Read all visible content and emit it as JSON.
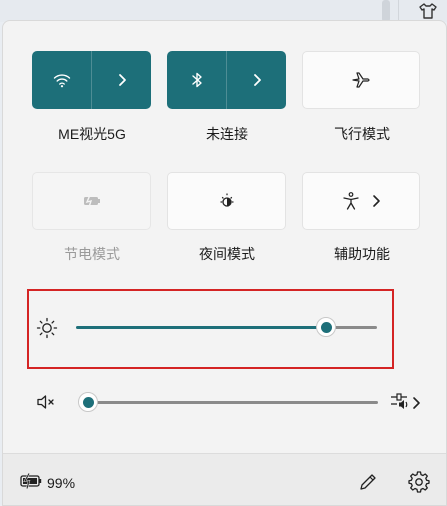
{
  "colors": {
    "accent": "#1d6f79",
    "track_inactive": "#8a8a8a",
    "highlight_border": "#d42424"
  },
  "quick_settings": {
    "tiles": [
      {
        "label": "ME视光5G",
        "state": "on",
        "icon": "wifi-icon",
        "has_chevron": true
      },
      {
        "label": "未连接",
        "state": "on",
        "icon": "bluetooth-icon",
        "has_chevron": true
      },
      {
        "label": "飞行模式",
        "state": "off",
        "icon": "airplane-icon"
      },
      {
        "label": "节电模式",
        "state": "disabled",
        "icon": "battery-saver-icon"
      },
      {
        "label": "夜间模式",
        "state": "off",
        "icon": "night-light-icon"
      },
      {
        "label": "辅助功能",
        "state": "off",
        "icon": "accessibility-icon",
        "has_chevron": true
      }
    ],
    "brightness": {
      "icon": "brightness-icon",
      "value_fraction": 0.83
    },
    "volume": {
      "icon": "speaker-muted-icon",
      "value_fraction": 0.0,
      "output_icon": "audio-output-icon"
    }
  },
  "footer": {
    "battery_percent": "99%",
    "battery_icon": "battery-charging-icon",
    "edit_icon": "pencil-icon",
    "settings_icon": "gear-icon"
  }
}
